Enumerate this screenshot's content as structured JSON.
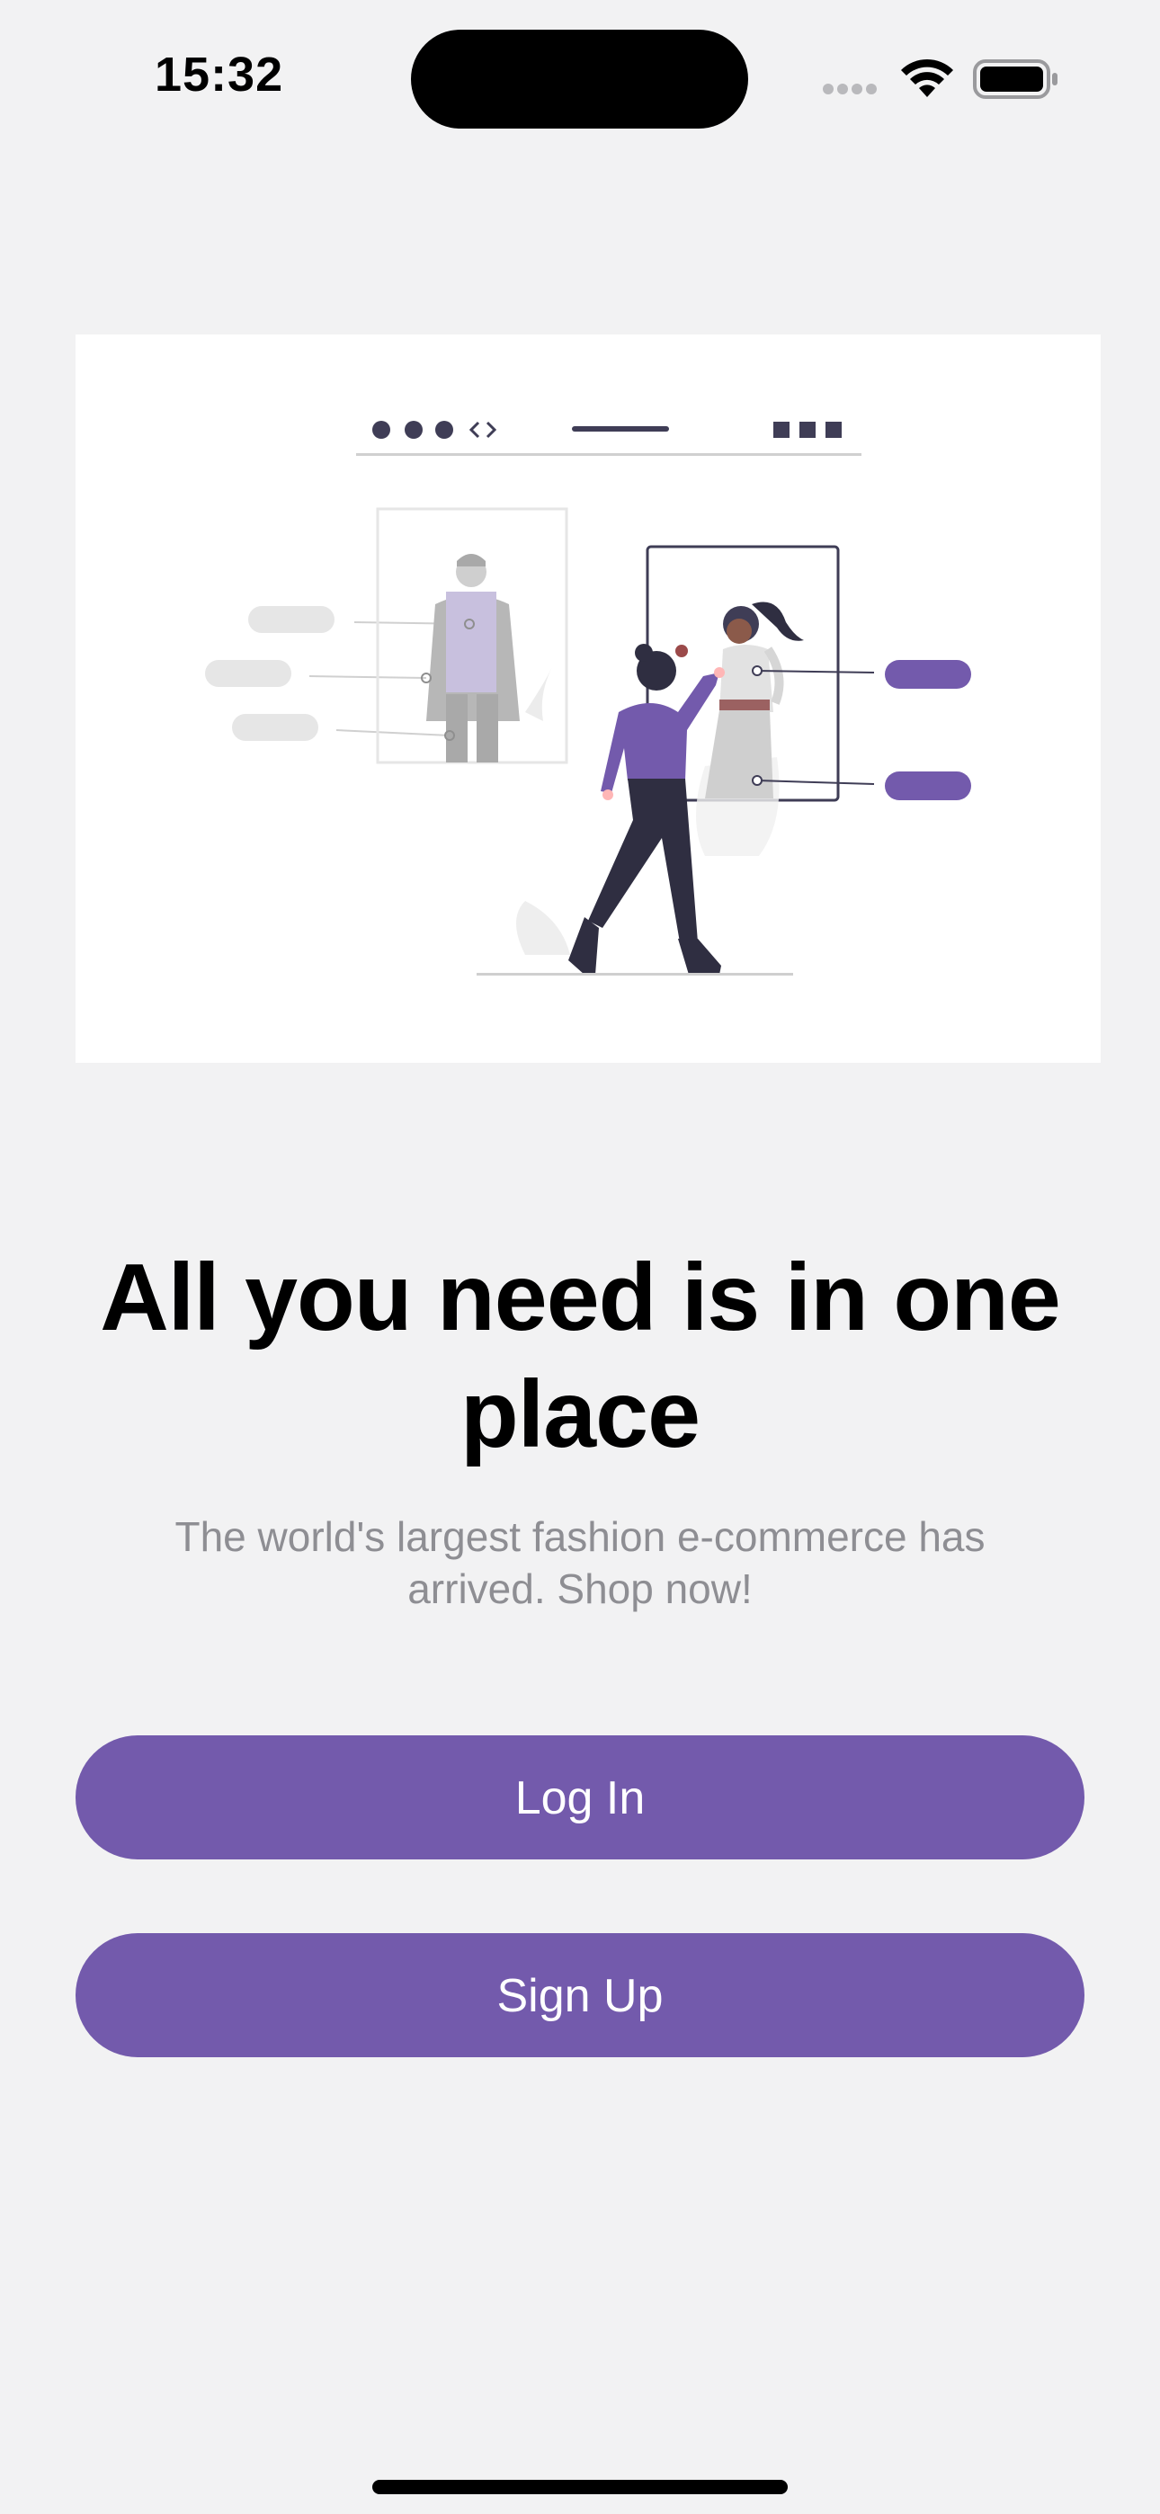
{
  "status_bar": {
    "time": "15:32",
    "icons": [
      "cellular-signal-icon",
      "wifi-icon",
      "battery-icon"
    ]
  },
  "hero": {
    "illustration": "fashion-browsing-illustration-icon"
  },
  "headline": "All you need is in one place",
  "subtext": "The world's largest fashion e-commerce has arrived. Shop now!",
  "buttons": {
    "login_label": "Log In",
    "signup_label": "Sign Up"
  },
  "colors": {
    "accent": "#735aac",
    "background": "#f2f2f3",
    "text_primary": "#000000",
    "text_secondary": "#8e8e93"
  }
}
